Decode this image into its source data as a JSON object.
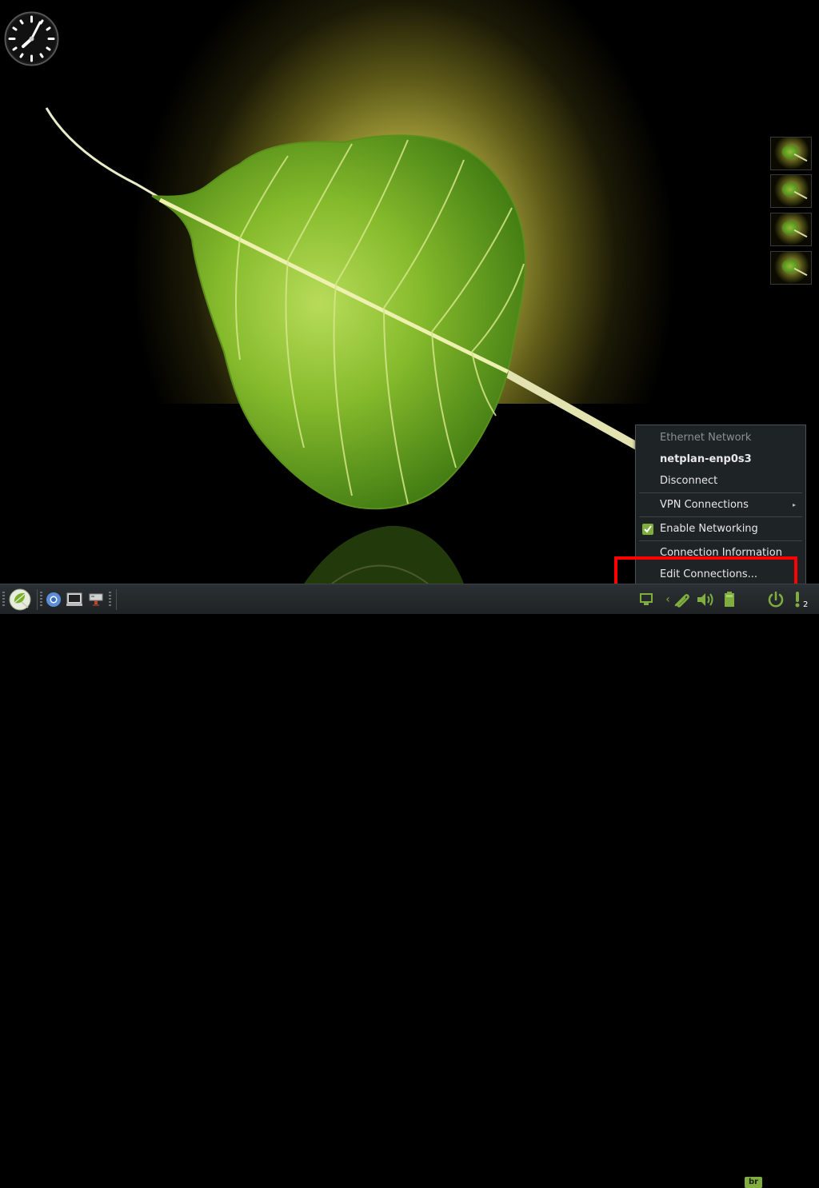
{
  "network_menu": {
    "header": "Ethernet Network",
    "connection_name": "netplan-enp0s3",
    "disconnect": "Disconnect",
    "vpn": "VPN Connections",
    "enable_networking": "Enable Networking",
    "enable_networking_checked": true,
    "connection_info": "Connection Information",
    "edit_connections": "Edit Connections..."
  },
  "taskbar": {
    "launchers": [
      "leaf-menu-icon",
      "chromium-icon",
      "terminal-icon",
      "file-manager-icon"
    ],
    "keyboard_layout": "br",
    "notification_count": "2"
  },
  "colors": {
    "accent_green": "#7fae3e",
    "highlight_box": "#ff0000",
    "menu_bg": "#1e2326"
  }
}
